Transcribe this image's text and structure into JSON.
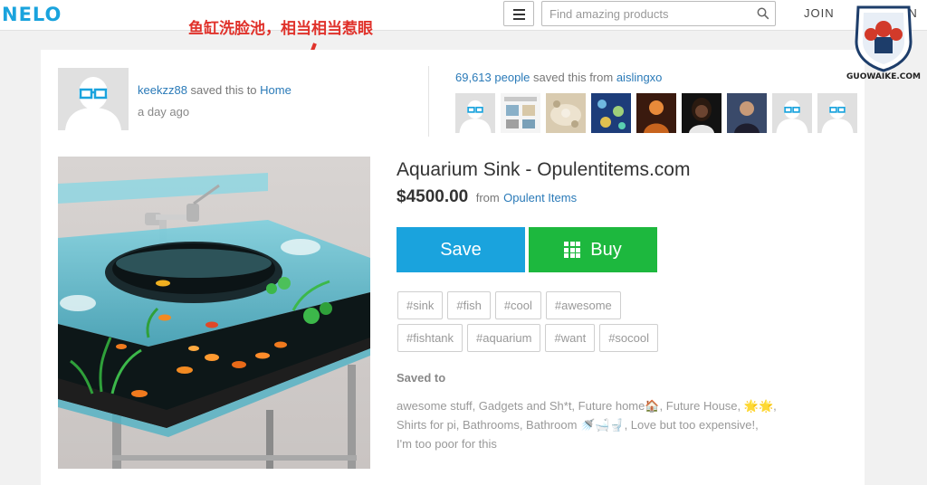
{
  "header": {
    "logo": "NELO",
    "search_placeholder": "Find amazing products",
    "join_label": "JOIN",
    "signin_label": "SIGN IN"
  },
  "watermark": {
    "text": "GUOWAIKE.COM"
  },
  "annotation": {
    "text": "鱼缸洗脸池，相当相当惹眼"
  },
  "activity": {
    "saver": "keekzz88",
    "saved_text": "saved this to",
    "board": "Home",
    "time": "a day ago",
    "count": "69,613 people",
    "count_text": "saved this from",
    "source_user": "aislingxo",
    "thumbs": [
      "avatar",
      "catalog",
      "stones",
      "fabric",
      "person",
      "person",
      "person",
      "avatar",
      "avatar"
    ]
  },
  "product": {
    "title": "Aquarium Sink - Opulentitems.com",
    "price": "$4500.00",
    "from_label": "from",
    "store": "Opulent Items",
    "save_label": "Save",
    "buy_label": "Buy",
    "tags": [
      "#sink",
      "#fish",
      "#cool",
      "#awesome",
      "#fishtank",
      "#aquarium",
      "#want",
      "#socool"
    ],
    "saved_to_label": "Saved to",
    "boards_line1": "awesome stuff, Gadgets and Sh*t, Future home🏠, Future House, 🌟🌟,",
    "boards_line2": "Shirts for pi, Bathrooms, Bathroom 🚿🛁🚽, Love but too expensive!,",
    "boards_line3": "I'm too poor for this"
  },
  "colors": {
    "accent": "#1aa3dd",
    "buy": "#1db83e",
    "link": "#2a7ab8",
    "annotation": "#e0322b"
  }
}
